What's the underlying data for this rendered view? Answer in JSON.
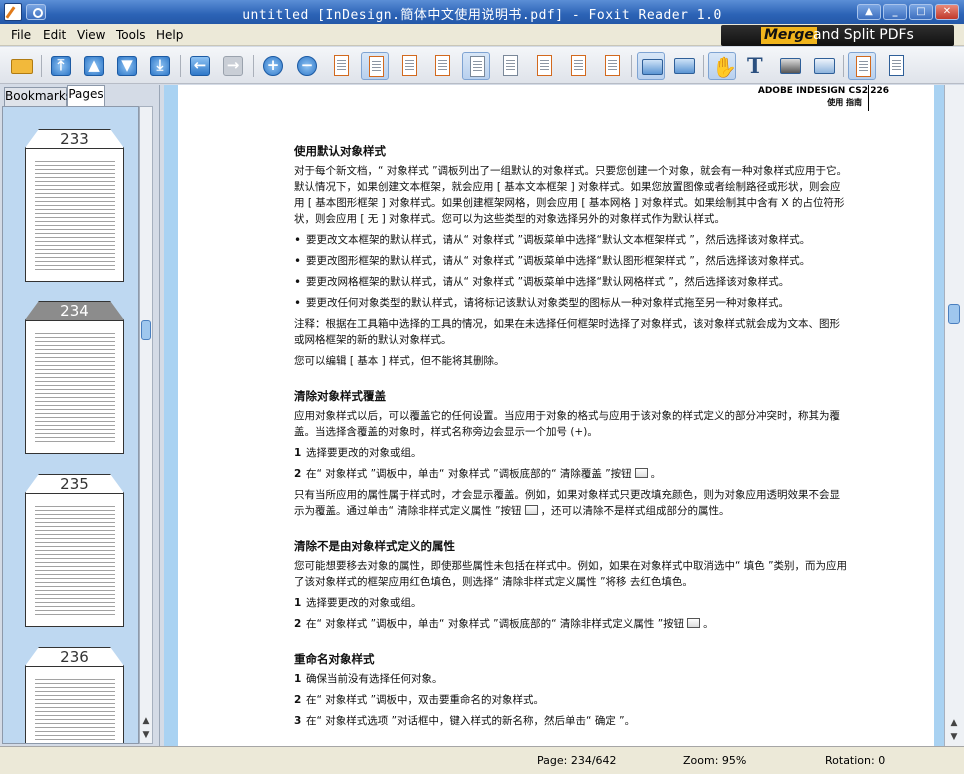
{
  "window": {
    "title": "untitled [InDesign.簡体中文使用说明书.pdf] - Foxit Reader 1.0"
  },
  "menu": [
    "File",
    "Edit",
    "View",
    "Tools",
    "Help"
  ],
  "banner": {
    "merge": "Merge",
    "rest": "and Split PDFs"
  },
  "tabs": {
    "bookmarks": "Bookmarks",
    "pages": "Pages"
  },
  "thumbnails": [
    "233",
    "234",
    "235",
    "236"
  ],
  "page": {
    "header_brand": "ADOBE INDESIGN CS2",
    "header_guide": "使用 指南",
    "number": "226",
    "s1": {
      "title": "使用默认对象样式",
      "p1": "对于每个新文档，“ 对象样式 ”调板列出了一组默认的对象样式。只要您创建一个对象，就会有一种对象样式应用于它。默认情况下，如果创建文本框架，就会应用 [ 基本文本框架 ] 对象样式。如果您放置图像或者绘制路径或形状，则会应用 [ 基本图形框架 ] 对象样式。如果创建框架网格，则会应用 [ 基本网格 ] 对象样式。如果绘制其中含有 X 的占位符形状，则会应用 [ 无 ] 对象样式。您可以为这些类型的对象选择另外的对象样式作为默认样式。",
      "b1": "要更改文本框架的默认样式，请从“ 对象样式 ”调板菜单中选择“默认文本框架样式 ”，然后选择该对象样式。",
      "b2": "要更改图形框架的默认样式，请从“ 对象样式 ”调板菜单中选择“默认图形框架样式 ”，然后选择该对象样式。",
      "b3": "要更改网格框架的默认样式，请从“ 对象样式 ”调板菜单中选择“默认网格样式 ”，然后选择该对象样式。",
      "b4": "要更改任何对象类型的默认样式，请将标记该默认对象类型的图标从一种对象样式拖至另一种对象样式。",
      "note": "注释：根据在工具箱中选择的工具的情况，如果在未选择任何框架时选择了对象样式，该对象样式就会成为文本、图形或网格框架的新的默认对象样式。",
      "p2": "您可以编辑 [ 基本 ] 样式，但不能将其删除。"
    },
    "s2": {
      "title": "清除对象样式覆盖",
      "p1": "应用对象样式以后，可以覆盖它的任何设置。当应用于对象的格式与应用于该对象的样式定义的部分冲突时，称其为覆盖。当选择含覆盖的对象时，样式名称旁边会显示一个加号 (+)。",
      "n1": "1",
      "step1": "选择要更改的对象或组。",
      "n2": "2",
      "step2": "在“ 对象样式 ”调板中，单击“ 对象样式 ”调板底部的“ 清除覆盖 ”按钮",
      "p2": "只有当所应用的属性属于样式时，才会显示覆盖。例如，如果对象样式只更改填充颜色，则为对象应用透明效果不会显示为覆盖。通过单击“ 清除非样式定义属性 ”按钮",
      "p2b": "，还可以清除不是样式组成部分的属性。"
    },
    "s3": {
      "title": "清除不是由对象样式定义的属性",
      "p1": "您可能想要移去对象的属性，即使那些属性未包括在样式中。例如，如果在对象样式中取消选中“ 填色 ”类别，而为应用了该对象样式的框架应用红色填色，则选择“ 清除非样式定义属性 ”将移 去红色填色。",
      "n1": "1",
      "step1": "选择要更改的对象或组。",
      "n2": "2",
      "step2": "在“ 对象样式 ”调板中，单击“ 对象样式 ”调板底部的“ 清除非样式定义属性 ”按钮"
    },
    "s4": {
      "title": "重命名对象样式",
      "n1": "1",
      "step1": "确保当前没有选择任何对象。",
      "n2": "2",
      "step2": "在“ 对象样式 ”调板中，双击要重命名的对象样式。",
      "n3": "3",
      "step3": "在“ 对象样式选项 ”对话框中，键入样式的新名称，然后单击“ 确定 ”。"
    }
  },
  "status": {
    "page": "Page: 234/642",
    "zoom": "Zoom: 95%",
    "rotation": "Rotation: 0"
  }
}
